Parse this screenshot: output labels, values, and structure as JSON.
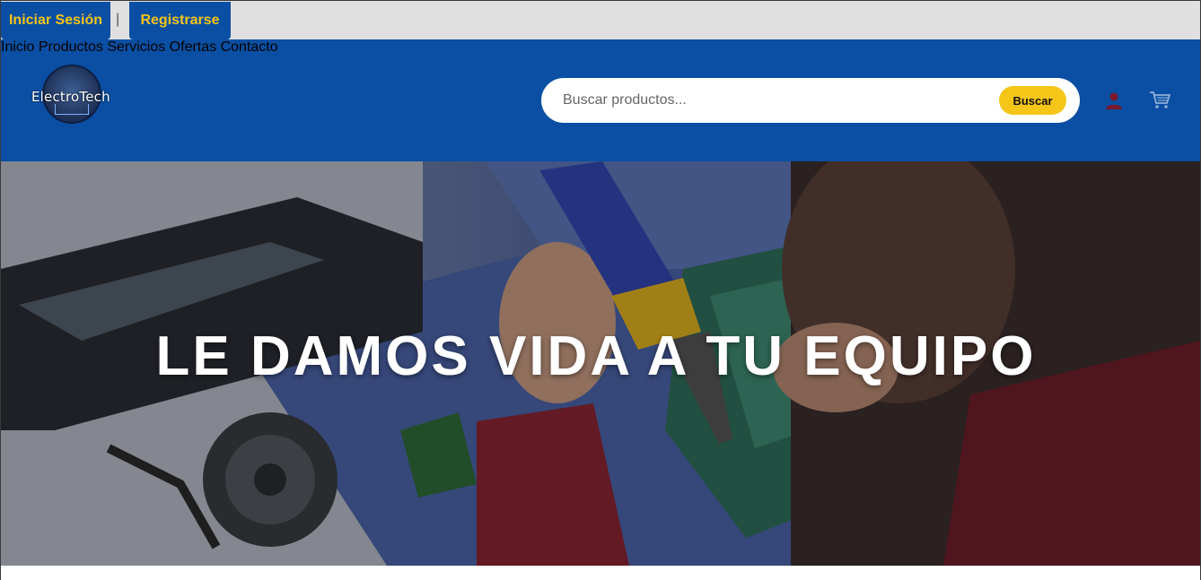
{
  "auth": {
    "login_label": "Iniciar Sesión",
    "separator": "|",
    "register_label": "Registrarse"
  },
  "header": {
    "logo_text": "ElectroTech",
    "nav": [
      {
        "label": "Inicio"
      },
      {
        "label": "Productos"
      },
      {
        "label": "Servicios"
      },
      {
        "label": "Ofertas"
      },
      {
        "label": "Contacto"
      }
    ],
    "search": {
      "placeholder": "Buscar productos...",
      "value": "",
      "button_label": "Buscar"
    },
    "icons": {
      "user": "user-icon",
      "cart": "cart-icon"
    }
  },
  "hero": {
    "title": "LE DAMOS VIDA A TU EQUIPO"
  },
  "colors": {
    "brand_blue": "#0a4fa3",
    "accent_yellow": "#f5c518",
    "topbar_bg": "#e0e0e0"
  }
}
